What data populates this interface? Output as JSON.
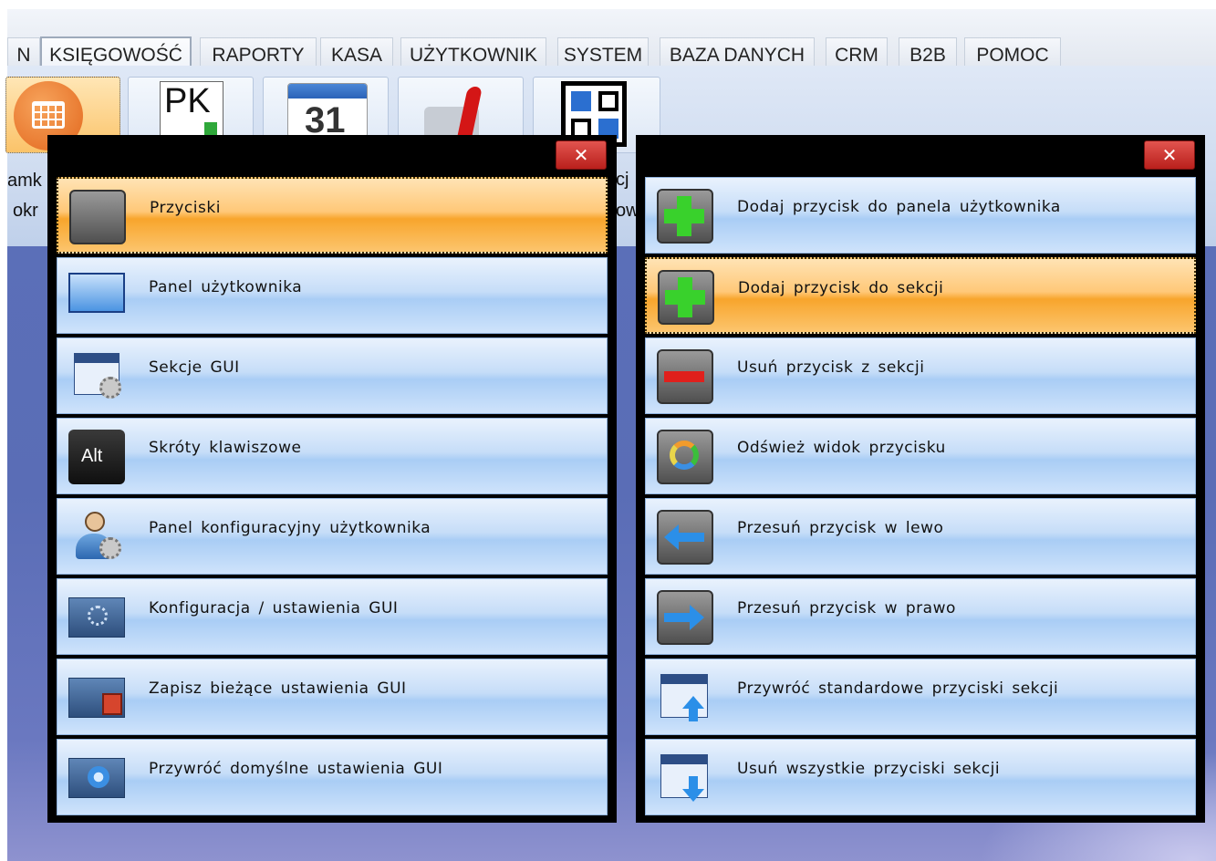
{
  "menu": {
    "tabs": [
      {
        "label": "N"
      },
      {
        "label": "KSIĘGOWOŚĆ"
      },
      {
        "label": "RAPORTY"
      },
      {
        "label": "KASA"
      },
      {
        "label": "UŻYTKOWNIK"
      },
      {
        "label": "SYSTEM"
      },
      {
        "label": "BAZA DANYCH"
      },
      {
        "label": "CRM"
      },
      {
        "label": "B2B"
      },
      {
        "label": "POMOC"
      }
    ],
    "active_tab": "KSIĘGOWOŚĆ"
  },
  "ribbon": {
    "pk_text": "PK",
    "calendar_day": "31",
    "partial_labels": [
      "amk",
      "okr",
      "cj",
      "ow"
    ]
  },
  "left_dialog": {
    "close_label": "✕",
    "items": [
      {
        "label": "Przyciski",
        "icon": "gray-button-icon",
        "active": true
      },
      {
        "label": "Panel użytkownika",
        "icon": "user-panel-icon"
      },
      {
        "label": "Sekcje GUI",
        "icon": "gui-sections-icon"
      },
      {
        "label": "Skróty klawiszowe",
        "icon": "alt-key-icon",
        "key_text": "Alt"
      },
      {
        "label": "Panel konfiguracyjny użytkownika",
        "icon": "user-config-icon"
      },
      {
        "label": "Konfiguracja / ustawienia GUI",
        "icon": "gui-settings-icon"
      },
      {
        "label": "Zapisz bieżące ustawienia GUI",
        "icon": "save-settings-icon"
      },
      {
        "label": "Przywróć domyślne ustawienia GUI",
        "icon": "restore-defaults-icon"
      }
    ]
  },
  "right_dialog": {
    "close_label": "✕",
    "items": [
      {
        "label": "Dodaj przycisk do panela użytkownika",
        "icon": "green-plus-icon"
      },
      {
        "label": "Dodaj przycisk do sekcji",
        "icon": "green-plus-icon",
        "active": true
      },
      {
        "label": "Usuń przycisk z sekcji",
        "icon": "red-minus-icon"
      },
      {
        "label": "Odśwież widok przycisku",
        "icon": "refresh-icon"
      },
      {
        "label": "Przesuń przycisk w lewo",
        "icon": "arrow-left-icon"
      },
      {
        "label": "Przesuń przycisk w prawo",
        "icon": "arrow-right-icon"
      },
      {
        "label": "Przywróć standardowe przyciski sekcji",
        "icon": "restore-section-icon"
      },
      {
        "label": "Usuń wszystkie przyciski sekcji",
        "icon": "remove-all-icon"
      }
    ]
  },
  "colors": {
    "active_item": "#f8a52c",
    "item": "#a9cdf5",
    "close_button": "#c9302c",
    "desktop": "#5b6fb8"
  }
}
